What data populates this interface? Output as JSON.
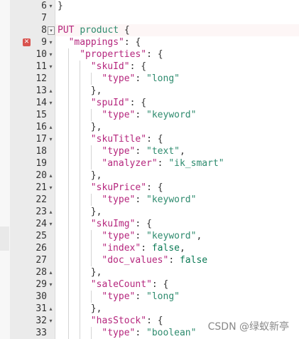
{
  "editor": {
    "error_marker": "✕",
    "lines": [
      {
        "n": "6",
        "fold": "▾",
        "boxed": false,
        "error": false,
        "indent": 0,
        "tokens": [
          {
            "t": "plain",
            "v": "}"
          }
        ]
      },
      {
        "n": "7",
        "fold": "",
        "boxed": false,
        "error": false,
        "indent": 0,
        "tokens": []
      },
      {
        "n": "8",
        "fold": "▾",
        "boxed": true,
        "error": false,
        "indent": 0,
        "tokens": [
          {
            "t": "kw",
            "v": "PUT "
          },
          {
            "t": "str",
            "v": "product"
          },
          {
            "t": "plain",
            "v": " {"
          }
        ]
      },
      {
        "n": "9",
        "fold": "▾",
        "boxed": false,
        "error": true,
        "indent": 1,
        "tokens": [
          {
            "t": "key",
            "v": "\"mappings\""
          },
          {
            "t": "plain",
            "v": ": {"
          }
        ]
      },
      {
        "n": "10",
        "fold": "▾",
        "boxed": false,
        "error": false,
        "indent": 2,
        "tokens": [
          {
            "t": "key",
            "v": "\"properties\""
          },
          {
            "t": "plain",
            "v": ": {"
          }
        ]
      },
      {
        "n": "11",
        "fold": "▾",
        "boxed": false,
        "error": false,
        "indent": 3,
        "tokens": [
          {
            "t": "key",
            "v": "\"skuId\""
          },
          {
            "t": "plain",
            "v": ": {"
          }
        ]
      },
      {
        "n": "12",
        "fold": "",
        "boxed": false,
        "error": false,
        "indent": 4,
        "tokens": [
          {
            "t": "key",
            "v": "\"type\""
          },
          {
            "t": "plain",
            "v": ": "
          },
          {
            "t": "str",
            "v": "\"long\""
          }
        ]
      },
      {
        "n": "13",
        "fold": "▴",
        "boxed": false,
        "error": false,
        "indent": 3,
        "tokens": [
          {
            "t": "plain",
            "v": "},"
          }
        ]
      },
      {
        "n": "14",
        "fold": "▾",
        "boxed": false,
        "error": false,
        "indent": 3,
        "tokens": [
          {
            "t": "key",
            "v": "\"spuId\""
          },
          {
            "t": "plain",
            "v": ": {"
          }
        ]
      },
      {
        "n": "15",
        "fold": "",
        "boxed": false,
        "error": false,
        "indent": 4,
        "tokens": [
          {
            "t": "key",
            "v": "\"type\""
          },
          {
            "t": "plain",
            "v": ": "
          },
          {
            "t": "str",
            "v": "\"keyword\""
          }
        ]
      },
      {
        "n": "16",
        "fold": "▴",
        "boxed": false,
        "error": false,
        "indent": 3,
        "tokens": [
          {
            "t": "plain",
            "v": "},"
          }
        ]
      },
      {
        "n": "17",
        "fold": "▾",
        "boxed": false,
        "error": false,
        "indent": 3,
        "tokens": [
          {
            "t": "key",
            "v": "\"skuTitle\""
          },
          {
            "t": "plain",
            "v": ": {"
          }
        ]
      },
      {
        "n": "18",
        "fold": "",
        "boxed": false,
        "error": false,
        "indent": 4,
        "tokens": [
          {
            "t": "key",
            "v": "\"type\""
          },
          {
            "t": "plain",
            "v": ": "
          },
          {
            "t": "str",
            "v": "\"text\""
          },
          {
            "t": "plain",
            "v": ","
          }
        ]
      },
      {
        "n": "19",
        "fold": "",
        "boxed": false,
        "error": false,
        "indent": 4,
        "tokens": [
          {
            "t": "key",
            "v": "\"analyzer\""
          },
          {
            "t": "plain",
            "v": ": "
          },
          {
            "t": "str",
            "v": "\"ik_smart\""
          }
        ]
      },
      {
        "n": "20",
        "fold": "▴",
        "boxed": false,
        "error": false,
        "indent": 3,
        "tokens": [
          {
            "t": "plain",
            "v": "},"
          }
        ]
      },
      {
        "n": "21",
        "fold": "▾",
        "boxed": false,
        "error": false,
        "indent": 3,
        "tokens": [
          {
            "t": "key",
            "v": "\"skuPrice\""
          },
          {
            "t": "plain",
            "v": ": {"
          }
        ]
      },
      {
        "n": "22",
        "fold": "",
        "boxed": false,
        "error": false,
        "indent": 4,
        "tokens": [
          {
            "t": "key",
            "v": "\"type\""
          },
          {
            "t": "plain",
            "v": ": "
          },
          {
            "t": "str",
            "v": "\"keyword\""
          }
        ]
      },
      {
        "n": "23",
        "fold": "▴",
        "boxed": false,
        "error": false,
        "indent": 3,
        "tokens": [
          {
            "t": "plain",
            "v": "},"
          }
        ]
      },
      {
        "n": "24",
        "fold": "▾",
        "boxed": false,
        "error": false,
        "indent": 3,
        "tokens": [
          {
            "t": "key",
            "v": "\"skuImg\""
          },
          {
            "t": "plain",
            "v": ": {"
          }
        ]
      },
      {
        "n": "25",
        "fold": "",
        "boxed": false,
        "error": false,
        "indent": 4,
        "tokens": [
          {
            "t": "key",
            "v": "\"type\""
          },
          {
            "t": "plain",
            "v": ": "
          },
          {
            "t": "str",
            "v": "\"keyword\""
          },
          {
            "t": "plain",
            "v": ","
          }
        ]
      },
      {
        "n": "26",
        "fold": "",
        "boxed": false,
        "error": false,
        "indent": 4,
        "tokens": [
          {
            "t": "key",
            "v": "\"index\""
          },
          {
            "t": "plain",
            "v": ": "
          },
          {
            "t": "num",
            "v": "false"
          },
          {
            "t": "plain",
            "v": ","
          }
        ]
      },
      {
        "n": "27",
        "fold": "",
        "boxed": false,
        "error": false,
        "indent": 4,
        "tokens": [
          {
            "t": "key",
            "v": "\"doc_values\""
          },
          {
            "t": "plain",
            "v": ": "
          },
          {
            "t": "num",
            "v": "false"
          }
        ]
      },
      {
        "n": "28",
        "fold": "▴",
        "boxed": false,
        "error": false,
        "indent": 3,
        "tokens": [
          {
            "t": "plain",
            "v": "},"
          }
        ]
      },
      {
        "n": "29",
        "fold": "▾",
        "boxed": false,
        "error": false,
        "indent": 3,
        "tokens": [
          {
            "t": "key",
            "v": "\"saleCount\""
          },
          {
            "t": "plain",
            "v": ": {"
          }
        ]
      },
      {
        "n": "30",
        "fold": "",
        "boxed": false,
        "error": false,
        "indent": 4,
        "tokens": [
          {
            "t": "key",
            "v": "\"type\""
          },
          {
            "t": "plain",
            "v": ": "
          },
          {
            "t": "str",
            "v": "\"long\""
          }
        ]
      },
      {
        "n": "31",
        "fold": "▴",
        "boxed": false,
        "error": false,
        "indent": 3,
        "tokens": [
          {
            "t": "plain",
            "v": "},"
          }
        ]
      },
      {
        "n": "32",
        "fold": "▾",
        "boxed": false,
        "error": false,
        "indent": 3,
        "tokens": [
          {
            "t": "key",
            "v": "\"hasStock\""
          },
          {
            "t": "plain",
            "v": ": {"
          }
        ]
      },
      {
        "n": "33",
        "fold": "",
        "boxed": false,
        "error": false,
        "indent": 4,
        "tokens": [
          {
            "t": "key",
            "v": "\"type\""
          },
          {
            "t": "plain",
            "v": ": "
          },
          {
            "t": "str",
            "v": "\"boolean\""
          }
        ]
      }
    ]
  },
  "watermark": "CSDN @绿蚁新亭",
  "colors": {
    "key": "#b5267d",
    "string": "#2e8b6e",
    "literal": "#0b7a55",
    "plain": "#333333",
    "error": "#d9534f",
    "gutter": "#ebebeb"
  }
}
